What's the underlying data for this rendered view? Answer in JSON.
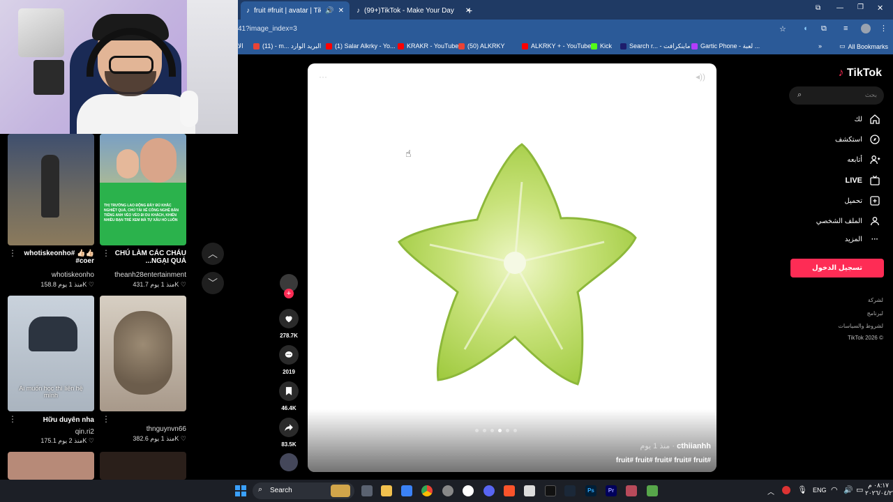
{
  "browser": {
    "tabs": [
      {
        "title": "fruit #fruit | avatar | TikTok#",
        "active": true
      },
      {
        "title": "(99+)TikTok - Make Your Day",
        "active": false
      }
    ],
    "new_tab": "+",
    "url": "41?image_index=3",
    "bookmarks": [
      {
        "label": "الا",
        "color": "#6b6b6b"
      },
      {
        "label": "(11) - m... البريد الوارد",
        "color": "#ea4335"
      },
      {
        "label": "(1) Salar Alkrky - Yo...",
        "color": "#ff0000"
      },
      {
        "label": "KRAKR - YouTube",
        "color": "#ff0000"
      },
      {
        "label": "(50) ALKRKY",
        "color": "#ea4335"
      },
      {
        "label": "ALKRKY + - YouTube",
        "color": "#ff0000"
      },
      {
        "label": "Kick",
        "color": "#53fc18"
      },
      {
        "label": "Search r... - ماينكرافت",
        "color": "#1d1d6b"
      },
      {
        "label": "Gartic Phone - لعبة ...",
        "color": "#b23cfd"
      }
    ],
    "more_bookmarks": "»",
    "all_bookmarks": "All Bookmarks"
  },
  "feed": {
    "videos": [
      {
        "caption": "whotiskeonho# 👍🏻👍🏻 #coer",
        "user": "whotiskeonho",
        "likes": "158.8K",
        "age": "منذ 1 يوم",
        "overlay": ""
      },
      {
        "caption": "CHÚ LÀM CÁC CHÁU ...NGẠI QUÁ",
        "user": "theanh28entertainment",
        "likes": "431.7K",
        "age": "منذ 1 يوم",
        "overlay": "THỊ TRƯỜNG LAO ĐỘNG ĐẦY ĐỦ KHẮC NGHIỆT QUÁ, CHÚ TÀI XẾ CÔNG NGHỆ BẮN TIẾNG ANH VÈO VÈO ĐI DU KHÁCH, KHIẾN NHIỀU BẠN TRẺ XEM MÀ TỰ XẤU HỔ LUÔN"
      },
      {
        "caption": "Hữu duyên nha",
        "user": "qin.ri2",
        "likes": "175.1K",
        "age": "منذ 2 يوم",
        "overlay": "Ai muốn học thì liên hệ mình"
      },
      {
        "caption": "",
        "user": "thnguynvn66",
        "likes": "382.6K",
        "age": "منذ 1 يوم",
        "overlay": ""
      }
    ],
    "scroll_up": "︿",
    "scroll_down": "﹀"
  },
  "post": {
    "author": "cthiianhh",
    "age": "منذ 1 يوم",
    "hashtags": "fruit# fruit# fruit# fruit# fruit#",
    "actions": [
      {
        "name": "like",
        "count": "278.7K"
      },
      {
        "name": "comment",
        "count": "2019"
      },
      {
        "name": "save",
        "count": "46.4K"
      },
      {
        "name": "share",
        "count": "83.5K"
      }
    ],
    "follow_label": "+"
  },
  "sidebar": {
    "logo": "TikTok",
    "search_placeholder": "بحث",
    "items": [
      {
        "label": "لك",
        "icon": "home-icon"
      },
      {
        "label": "استكشف",
        "icon": "compass-icon"
      },
      {
        "label": "أتابعه",
        "icon": "following-icon"
      },
      {
        "label": "LIVE",
        "icon": "live-icon"
      },
      {
        "label": "تحميل",
        "icon": "upload-icon"
      },
      {
        "label": "الملف الشخصي",
        "icon": "profile-icon"
      },
      {
        "label": "المزيد",
        "icon": "more-icon"
      }
    ],
    "login_button": "تسجيل الدخول",
    "footer": [
      "لشركة",
      "لبرنامج",
      "لشروط والسياسات",
      "TikTok 2026 ©"
    ],
    "accent": "#fe2c55"
  },
  "taskbar": {
    "search_label": "Search",
    "language": "ENG",
    "time": "٠٨:١٧ م",
    "date": "٢٠٢٦/٠٤/٢٧"
  }
}
